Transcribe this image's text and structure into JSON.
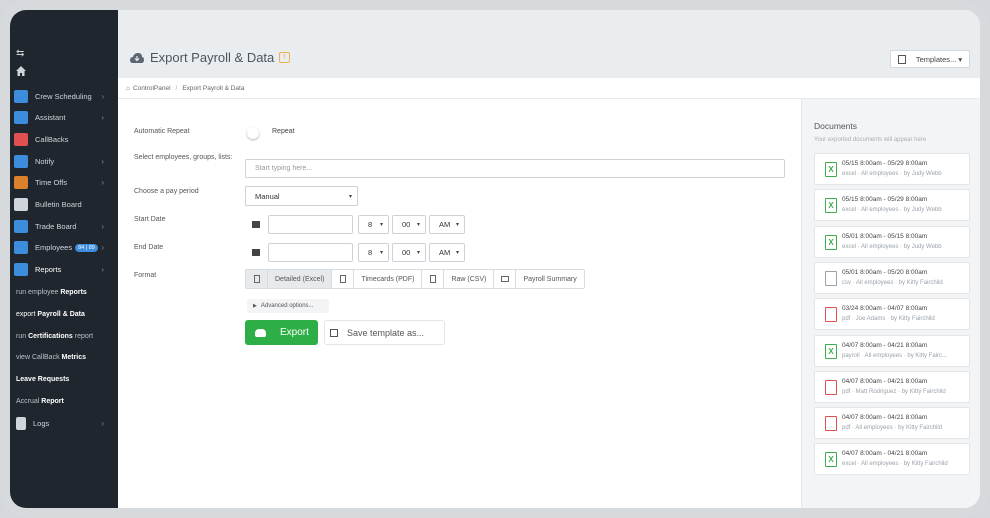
{
  "sidebar": {
    "items": [
      {
        "label": "Crew Scheduling",
        "icon": "calendar-icon",
        "color": "#3c8dde",
        "chevron": "›"
      },
      {
        "label": "Assistant",
        "icon": "robot-icon",
        "color": "#3c8dde",
        "chevron": "›"
      },
      {
        "label": "CallBacks",
        "icon": "phone-icon",
        "color": "#e05050",
        "chevron": ""
      },
      {
        "label": "Notify",
        "icon": "envelope-icon",
        "color": "#3c8dde",
        "chevron": "›"
      },
      {
        "label": "Time Offs",
        "icon": "suitcase-icon",
        "color": "#d9822b",
        "chevron": "›"
      },
      {
        "label": "Bulletin Board",
        "icon": "clipboard-icon",
        "color": "#cfd5db",
        "chevron": ""
      },
      {
        "label": "Trade Board",
        "icon": "shuffle-icon",
        "color": "#3c8dde",
        "chevron": "›"
      },
      {
        "label": "Employees",
        "icon": "users-icon",
        "color": "#3c8dde",
        "badge": "84 | 89",
        "chevron": "›"
      },
      {
        "label": "Reports",
        "icon": "bar-chart-icon",
        "color": "#3c8dde",
        "chevron": "›"
      }
    ],
    "subitems": [
      {
        "pre": "run employee ",
        "bold": "Reports",
        "post": ""
      },
      {
        "pre": "export ",
        "bold": "Payroll & Data",
        "post": ""
      },
      {
        "pre": "run ",
        "bold": "Certifications",
        "post": " report"
      },
      {
        "pre": "view CallBack ",
        "bold": "Metrics",
        "post": ""
      },
      {
        "pre": "",
        "bold": "Leave Requests",
        "post": ""
      },
      {
        "pre": "Accrual ",
        "bold": "Report",
        "post": ""
      }
    ],
    "logs": {
      "label": "Logs",
      "icon": "file-icon",
      "chevron": "›"
    }
  },
  "header": {
    "title": "Export Payroll & Data",
    "templates_button": "Templates... ▾"
  },
  "breadcrumb": {
    "home": "ControlPanel",
    "current": "Export Payroll & Data"
  },
  "form": {
    "automatic_repeat_label": "Automatic Repeat",
    "repeat_label": "Repeat",
    "select_label": "Select employees, groups, lists:",
    "select_placeholder": "Start typing here...",
    "pay_period_label": "Choose a pay period",
    "pay_period_value": "Manual",
    "start_date_label": "Start Date",
    "end_date_label": "End Date",
    "start_hour": "8",
    "start_minute": "00",
    "start_ampm": "AM",
    "end_hour": "8",
    "end_minute": "00",
    "end_ampm": "AM",
    "format_label": "Format",
    "formats": [
      "Detailed (Excel)",
      "Timecards (PDF)",
      "Raw (CSV)",
      "Payroll Summary"
    ],
    "advanced": "Advanced options...",
    "export_button": "Export",
    "save_template_button": "Save template as..."
  },
  "documents": {
    "title": "Documents",
    "subtitle": "Your exported documents will appear here",
    "items": [
      {
        "type": "excel",
        "range": "05/15 8:00am - 05/29 8:00am",
        "meta": "excel · All employees · by Judy Webb"
      },
      {
        "type": "excel",
        "range": "05/15 8:00am - 05/29 8:00am",
        "meta": "excel · All employees · by Judy Webb"
      },
      {
        "type": "excel",
        "range": "05/01 8:00am - 05/15 8:00am",
        "meta": "excel · All employees · by Judy Webb"
      },
      {
        "type": "csv",
        "range": "05/01 8:00am - 05/20 8:00am",
        "meta": "csv · All employees · by Kitty Fairchild"
      },
      {
        "type": "pdf",
        "range": "03/24 8:00am - 04/07 8:00am",
        "meta": "pdf · Joe Adams · by Kitty Fairchild"
      },
      {
        "type": "excel",
        "range": "04/07 8:00am - 04/21 8:00am",
        "meta": "payroll · All employees · by Kitty Fairc..."
      },
      {
        "type": "pdf",
        "range": "04/07 8:00am - 04/21 8:00am",
        "meta": "pdf · Matt Rodriguez · by Kitty Fairchild"
      },
      {
        "type": "pdf",
        "range": "04/07 8:00am - 04/21 8:00am",
        "meta": "pdf · All employees · by Kitty Fairchild"
      },
      {
        "type": "excel",
        "range": "04/07 8:00am - 04/21 8:00am",
        "meta": "excel · All employees · by Kitty Fairchild"
      }
    ]
  }
}
